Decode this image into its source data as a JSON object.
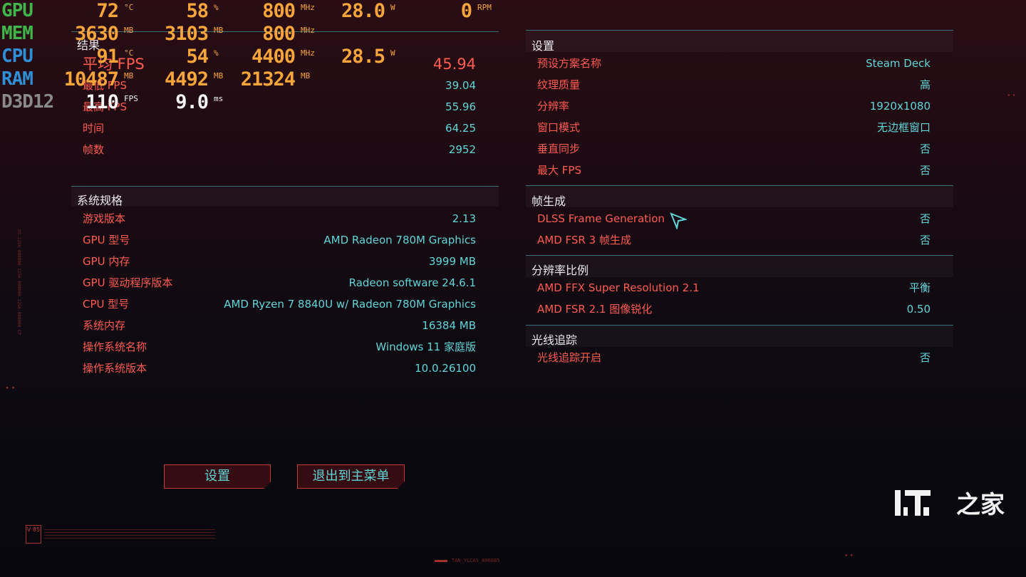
{
  "results": {
    "title": "结果",
    "rows": [
      {
        "k": "平均 FPS",
        "v": "45.94"
      },
      {
        "k": "最低 FPS",
        "v": "39.04"
      },
      {
        "k": "最高 FPS",
        "v": "55.96"
      },
      {
        "k": "时间",
        "v": "64.25"
      },
      {
        "k": "帧数",
        "v": "2952"
      }
    ]
  },
  "system": {
    "title": "系统规格",
    "rows": [
      {
        "k": "游戏版本",
        "v": "2.13"
      },
      {
        "k": "GPU 型号",
        "v": "AMD Radeon 780M Graphics"
      },
      {
        "k": "GPU 内存",
        "v": "3999 MB"
      },
      {
        "k": "GPU 驱动程序版本",
        "v": "Radeon software 24.6.1"
      },
      {
        "k": "CPU 型号",
        "v": "AMD Ryzen 7 8840U w/ Radeon 780M Graphics"
      },
      {
        "k": "系统内存",
        "v": "16384 MB"
      },
      {
        "k": "操作系统名称",
        "v": "Windows 11 家庭版"
      },
      {
        "k": "操作系统版本",
        "v": "10.0.26100"
      }
    ]
  },
  "settings": {
    "title": "设置",
    "rows": [
      {
        "k": "预设方案名称",
        "v": "Steam Deck"
      },
      {
        "k": "纹理质量",
        "v": "高"
      },
      {
        "k": "分辨率",
        "v": "1920x1080"
      },
      {
        "k": "窗口模式",
        "v": "无边框窗口"
      },
      {
        "k": "垂直同步",
        "v": "否"
      },
      {
        "k": "最大 FPS",
        "v": "否"
      }
    ]
  },
  "framegen": {
    "title": "帧生成",
    "rows": [
      {
        "k": "DLSS Frame Generation",
        "v": "否"
      },
      {
        "k": "AMD FSR 3 帧生成",
        "v": "否"
      }
    ]
  },
  "scaling": {
    "title": "分辨率比例",
    "rows": [
      {
        "k": "AMD FFX Super Resolution 2.1",
        "v": "平衡"
      },
      {
        "k": "AMD FSR 2.1 图像锐化",
        "v": "0.50"
      }
    ]
  },
  "raytracing": {
    "title": "光线追踪",
    "rows": [
      {
        "k": "光线追踪开启",
        "v": "否"
      }
    ]
  },
  "buttons": {
    "settings": "设置",
    "exit": "退出到主菜单"
  },
  "osd": {
    "gpu": {
      "label": "GPU",
      "color": "#3fb54a",
      "vals": [
        [
          "72",
          "°C"
        ],
        [
          "58",
          "%"
        ],
        [
          "800",
          "MHz"
        ],
        [
          "28.0",
          "W"
        ],
        [
          "0",
          "RPM"
        ]
      ]
    },
    "mem": {
      "label": "MEM",
      "color": "#3fb54a",
      "vals": [
        [
          "3630",
          "MB"
        ],
        [
          "3103",
          "MB"
        ],
        [
          "800",
          "MHz"
        ]
      ]
    },
    "cpu": {
      "label": "CPU",
      "color": "#2f8fd6",
      "vals": [
        [
          "91",
          "°C"
        ],
        [
          "54",
          "%"
        ],
        [
          "4400",
          "MHz"
        ],
        [
          "28.5",
          "W"
        ]
      ]
    },
    "ram": {
      "label": "RAM",
      "color": "#2f8fd6",
      "vals": [
        [
          "10487",
          "MB"
        ],
        [
          "4492",
          "MB"
        ],
        [
          "21324",
          "MB"
        ]
      ]
    },
    "d3d": {
      "label": "D3D12",
      "color": "#8a8a8a",
      "vals": [
        [
          "110",
          "FPS"
        ],
        [
          "9.0",
          "ms"
        ]
      ]
    }
  },
  "logo": {
    "text": "IT之家"
  },
  "footer": {
    "version_badge": "V 85",
    "code": "TAN_YLCAS_000085"
  }
}
